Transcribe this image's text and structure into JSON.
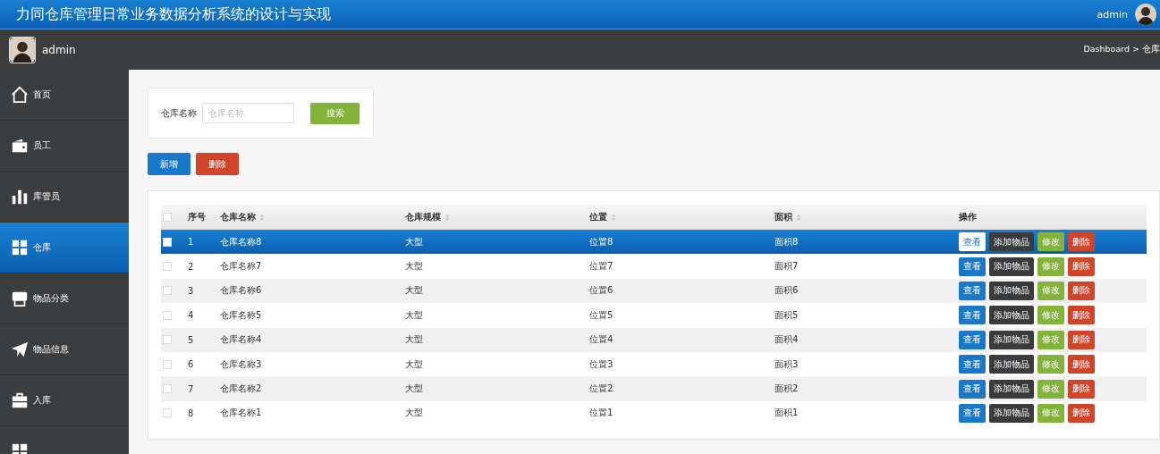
{
  "header": {
    "title": "力同仓库管理日常业务数据分析系统的设计与实现",
    "user": "admin"
  },
  "subbar": {
    "user": "admin",
    "breadcrumb": "Dashboard > 仓库"
  },
  "sidebar": {
    "items": [
      {
        "label": "首页",
        "selected": false
      },
      {
        "label": "员工",
        "selected": false
      },
      {
        "label": "库管员",
        "selected": false
      },
      {
        "label": "仓库",
        "selected": true
      },
      {
        "label": "物品分类",
        "selected": false
      },
      {
        "label": "物品信息",
        "selected": false
      },
      {
        "label": "入库",
        "selected": false
      },
      {
        "selected": false
      }
    ]
  },
  "search": {
    "label": "仓库名称",
    "placeholder": "仓库名称",
    "button": "搜索"
  },
  "toolbar": [
    {
      "label": "新增",
      "kind": "primary"
    },
    {
      "label": "删除",
      "kind": "danger"
    }
  ],
  "table": {
    "select_all": {
      "checked": false
    },
    "columns": [
      {
        "label": "序号",
        "sortable": false
      },
      {
        "label": "仓库名称",
        "sortable": true
      },
      {
        "label": "仓库规模",
        "sortable": true
      },
      {
        "label": "位置",
        "sortable": true
      },
      {
        "label": "面积",
        "sortable": true
      },
      {
        "label": "操作",
        "sortable": false
      }
    ],
    "rows": [
      {
        "selected": true,
        "checked": false,
        "cells": [
          "1",
          "仓库名称8",
          "大型",
          "位置8",
          "面积8"
        ],
        "actions": [
          {
            "label": "查看",
            "kind": "view"
          },
          {
            "label": "添加物品",
            "kind": "add"
          },
          {
            "label": "修改",
            "kind": "edit"
          },
          {
            "label": "删除",
            "kind": "delete"
          }
        ]
      },
      {
        "selected": false,
        "checked": false,
        "cells": [
          "2",
          "仓库名称7",
          "大型",
          "位置7",
          "面积7"
        ],
        "actions": [
          {
            "label": "查看",
            "kind": "view"
          },
          {
            "label": "添加物品",
            "kind": "add"
          },
          {
            "label": "修改",
            "kind": "edit"
          },
          {
            "label": "删除",
            "kind": "delete"
          }
        ]
      },
      {
        "selected": false,
        "checked": false,
        "cells": [
          "3",
          "仓库名称6",
          "大型",
          "位置6",
          "面积6"
        ],
        "actions": [
          {
            "label": "查看",
            "kind": "view"
          },
          {
            "label": "添加物品",
            "kind": "add"
          },
          {
            "label": "修改",
            "kind": "edit"
          },
          {
            "label": "删除",
            "kind": "delete"
          }
        ]
      },
      {
        "selected": false,
        "checked": false,
        "cells": [
          "4",
          "仓库名称5",
          "大型",
          "位置5",
          "面积5"
        ],
        "actions": [
          {
            "label": "查看",
            "kind": "view"
          },
          {
            "label": "添加物品",
            "kind": "add"
          },
          {
            "label": "修改",
            "kind": "edit"
          },
          {
            "label": "删除",
            "kind": "delete"
          }
        ]
      },
      {
        "selected": false,
        "checked": false,
        "cells": [
          "5",
          "仓库名称4",
          "大型",
          "位置4",
          "面积4"
        ],
        "actions": [
          {
            "label": "查看",
            "kind": "view"
          },
          {
            "label": "添加物品",
            "kind": "add"
          },
          {
            "label": "修改",
            "kind": "edit"
          },
          {
            "label": "删除",
            "kind": "delete"
          }
        ]
      },
      {
        "selected": false,
        "checked": false,
        "cells": [
          "6",
          "仓库名称3",
          "大型",
          "位置3",
          "面积3"
        ],
        "actions": [
          {
            "label": "查看",
            "kind": "view"
          },
          {
            "label": "添加物品",
            "kind": "add"
          },
          {
            "label": "修改",
            "kind": "edit"
          },
          {
            "label": "删除",
            "kind": "delete"
          }
        ]
      },
      {
        "selected": false,
        "checked": false,
        "cells": [
          "7",
          "仓库名称2",
          "大型",
          "位置2",
          "面积2"
        ],
        "actions": [
          {
            "label": "查看",
            "kind": "view"
          },
          {
            "label": "添加物品",
            "kind": "add"
          },
          {
            "label": "修改",
            "kind": "edit"
          },
          {
            "label": "删除",
            "kind": "delete"
          }
        ]
      },
      {
        "selected": false,
        "checked": false,
        "cells": [
          "8",
          "仓库名称1",
          "大型",
          "位置1",
          "面积1"
        ],
        "actions": [
          {
            "label": "查看",
            "kind": "view"
          },
          {
            "label": "添加物品",
            "kind": "add"
          },
          {
            "label": "修改",
            "kind": "edit"
          },
          {
            "label": "删除",
            "kind": "delete"
          }
        ]
      }
    ]
  }
}
